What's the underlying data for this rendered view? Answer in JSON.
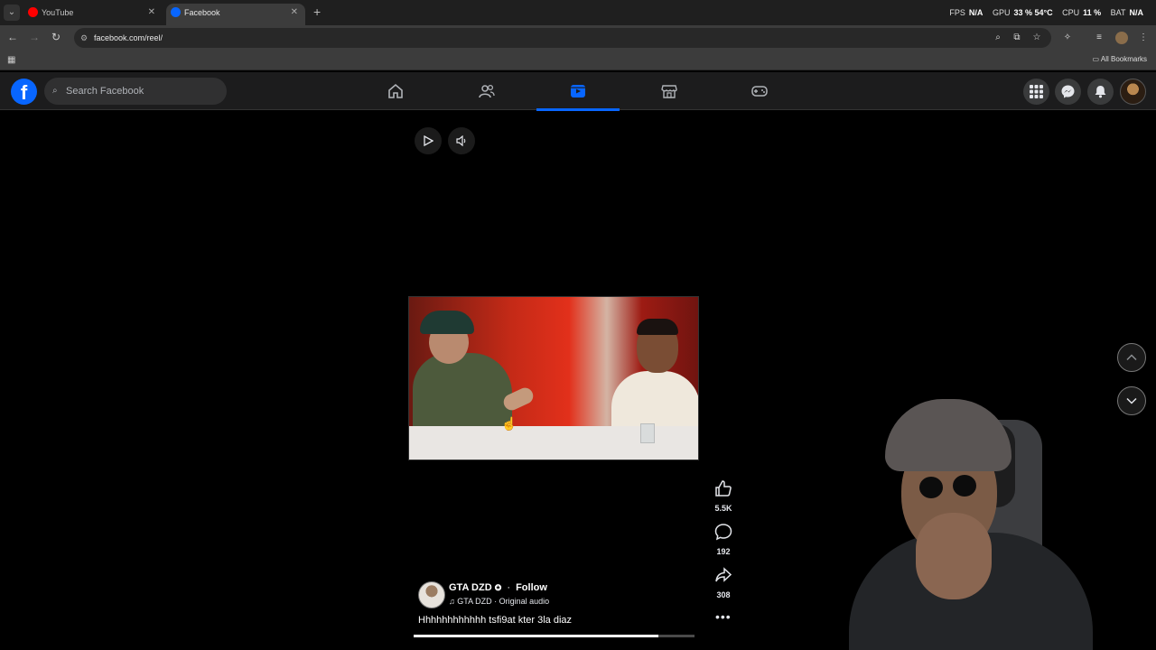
{
  "browser": {
    "tabs": [
      {
        "title": "YouTube",
        "active": false,
        "favicon_color": "#ff0000"
      },
      {
        "title": "Facebook",
        "active": true,
        "favicon_color": "#0866ff"
      }
    ],
    "new_tab": "+",
    "url": "facebook.com/reel/",
    "all_bookmarks": "All Bookmarks",
    "hud": {
      "fps_label": "FPS",
      "fps_value": "N/A",
      "gpu_label": "GPU",
      "gpu_value": "33 % 54°C",
      "cpu_label": "CPU",
      "cpu_value": "11 %",
      "bat_label": "BAT",
      "bat_value": "N/A"
    }
  },
  "facebook": {
    "search_placeholder": "Search Facebook",
    "nav_tabs": [
      {
        "icon": "home-icon",
        "active": false
      },
      {
        "icon": "friends-icon",
        "active": false
      },
      {
        "icon": "video-icon",
        "active": true
      },
      {
        "icon": "marketplace-icon",
        "active": false
      },
      {
        "icon": "gaming-icon",
        "active": false
      }
    ],
    "accent": "#0866ff"
  },
  "reel": {
    "likes": "5.5K",
    "comments": "192",
    "shares": "308",
    "author": "GTA DZD",
    "follow": "Follow",
    "audio": "GTA DZD · Original audio",
    "caption": "Hhhhhhhhhhhh tsfi9at kter 3la diaz",
    "progress_fraction": 0.87
  }
}
